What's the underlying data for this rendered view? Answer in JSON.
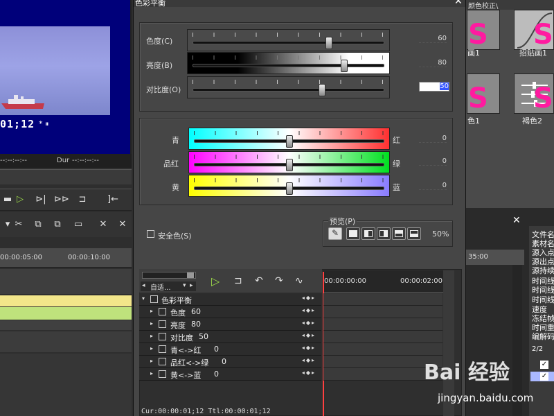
{
  "dialog": {
    "title": "色彩平衡",
    "close": "✕",
    "sliders": [
      {
        "label": "色度(C)",
        "value": "60",
        "level": 0.72
      },
      {
        "label": "亮度(B)",
        "value": "80",
        "level": 0.8
      },
      {
        "label": "对比度(O)",
        "value": "50",
        "level": 0.68
      }
    ],
    "balance": [
      {
        "left": "青",
        "right": "红",
        "value": "0",
        "level": 0.5
      },
      {
        "left": "品红",
        "right": "绿",
        "value": "0",
        "level": 0.5
      },
      {
        "left": "黄",
        "right": "蓝",
        "value": "0",
        "level": 0.5
      }
    ],
    "safe_color": "安全色(S)",
    "preview": {
      "label": "预览(P)",
      "zoom": "50%"
    },
    "kf": {
      "dropdown": "自适...",
      "ruler_start": "00:00:00:00",
      "ruler_next": "00:00:02:00",
      "rows": [
        {
          "name": "色彩平衡",
          "value": ""
        },
        {
          "name": "色度",
          "value": "60"
        },
        {
          "name": "亮度",
          "value": "80"
        },
        {
          "name": "对比度",
          "value": "50"
        },
        {
          "name": "青<->红",
          "value": "0"
        },
        {
          "name": "品红<->绿",
          "value": "0"
        },
        {
          "name": "黄<->蓝",
          "value": "0"
        }
      ],
      "status": "Cur:00:00:01;12 Ttl:00:00:01;12"
    }
  },
  "player": {
    "timecode": "01;12",
    "flags": "* ⏸",
    "in_point": "--:--:--:--",
    "dur_label": "Dur",
    "dur_value": "--:--:--:--"
  },
  "timeline": {
    "t1": "00:00:05:00",
    "t2": "00:00:10:00",
    "t3": "35:00"
  },
  "effects": {
    "header": "颜色校正\\",
    "items": [
      {
        "label": "画1"
      },
      {
        "label": "招贴画1"
      },
      {
        "label": "色1"
      },
      {
        "label": "褐色2"
      }
    ]
  },
  "bin": {
    "close": "✕",
    "columns": [
      "文件名",
      "素材名",
      "源入点",
      "源出点",
      "源持续",
      "时间线",
      "时间线",
      "时间线",
      "速度",
      "冻结帧",
      "时间重",
      "编解码"
    ],
    "count": "2/2"
  },
  "watermark": {
    "brand": "Bai 经验",
    "url": "jingyan.baidu.com"
  }
}
